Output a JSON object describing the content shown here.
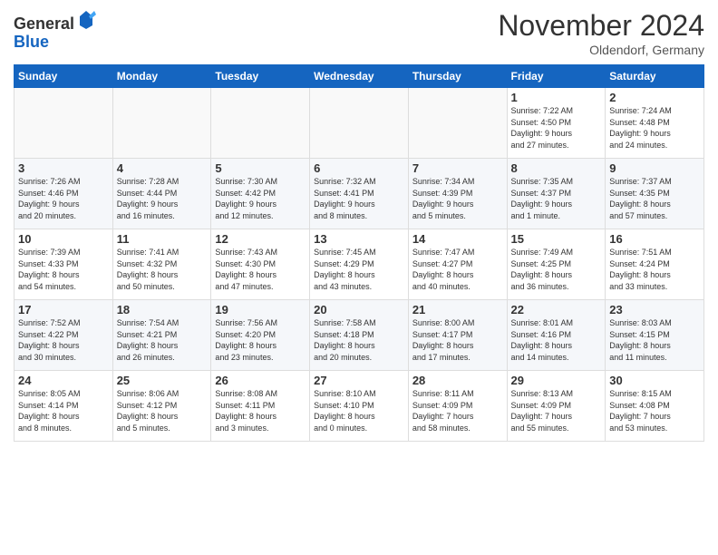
{
  "header": {
    "logo_line1": "General",
    "logo_line2": "Blue",
    "month_title": "November 2024",
    "location": "Oldendorf, Germany"
  },
  "weekdays": [
    "Sunday",
    "Monday",
    "Tuesday",
    "Wednesday",
    "Thursday",
    "Friday",
    "Saturday"
  ],
  "weeks": [
    [
      {
        "day": "",
        "info": ""
      },
      {
        "day": "",
        "info": ""
      },
      {
        "day": "",
        "info": ""
      },
      {
        "day": "",
        "info": ""
      },
      {
        "day": "",
        "info": ""
      },
      {
        "day": "1",
        "info": "Sunrise: 7:22 AM\nSunset: 4:50 PM\nDaylight: 9 hours\nand 27 minutes."
      },
      {
        "day": "2",
        "info": "Sunrise: 7:24 AM\nSunset: 4:48 PM\nDaylight: 9 hours\nand 24 minutes."
      }
    ],
    [
      {
        "day": "3",
        "info": "Sunrise: 7:26 AM\nSunset: 4:46 PM\nDaylight: 9 hours\nand 20 minutes."
      },
      {
        "day": "4",
        "info": "Sunrise: 7:28 AM\nSunset: 4:44 PM\nDaylight: 9 hours\nand 16 minutes."
      },
      {
        "day": "5",
        "info": "Sunrise: 7:30 AM\nSunset: 4:42 PM\nDaylight: 9 hours\nand 12 minutes."
      },
      {
        "day": "6",
        "info": "Sunrise: 7:32 AM\nSunset: 4:41 PM\nDaylight: 9 hours\nand 8 minutes."
      },
      {
        "day": "7",
        "info": "Sunrise: 7:34 AM\nSunset: 4:39 PM\nDaylight: 9 hours\nand 5 minutes."
      },
      {
        "day": "8",
        "info": "Sunrise: 7:35 AM\nSunset: 4:37 PM\nDaylight: 9 hours\nand 1 minute."
      },
      {
        "day": "9",
        "info": "Sunrise: 7:37 AM\nSunset: 4:35 PM\nDaylight: 8 hours\nand 57 minutes."
      }
    ],
    [
      {
        "day": "10",
        "info": "Sunrise: 7:39 AM\nSunset: 4:33 PM\nDaylight: 8 hours\nand 54 minutes."
      },
      {
        "day": "11",
        "info": "Sunrise: 7:41 AM\nSunset: 4:32 PM\nDaylight: 8 hours\nand 50 minutes."
      },
      {
        "day": "12",
        "info": "Sunrise: 7:43 AM\nSunset: 4:30 PM\nDaylight: 8 hours\nand 47 minutes."
      },
      {
        "day": "13",
        "info": "Sunrise: 7:45 AM\nSunset: 4:29 PM\nDaylight: 8 hours\nand 43 minutes."
      },
      {
        "day": "14",
        "info": "Sunrise: 7:47 AM\nSunset: 4:27 PM\nDaylight: 8 hours\nand 40 minutes."
      },
      {
        "day": "15",
        "info": "Sunrise: 7:49 AM\nSunset: 4:25 PM\nDaylight: 8 hours\nand 36 minutes."
      },
      {
        "day": "16",
        "info": "Sunrise: 7:51 AM\nSunset: 4:24 PM\nDaylight: 8 hours\nand 33 minutes."
      }
    ],
    [
      {
        "day": "17",
        "info": "Sunrise: 7:52 AM\nSunset: 4:22 PM\nDaylight: 8 hours\nand 30 minutes."
      },
      {
        "day": "18",
        "info": "Sunrise: 7:54 AM\nSunset: 4:21 PM\nDaylight: 8 hours\nand 26 minutes."
      },
      {
        "day": "19",
        "info": "Sunrise: 7:56 AM\nSunset: 4:20 PM\nDaylight: 8 hours\nand 23 minutes."
      },
      {
        "day": "20",
        "info": "Sunrise: 7:58 AM\nSunset: 4:18 PM\nDaylight: 8 hours\nand 20 minutes."
      },
      {
        "day": "21",
        "info": "Sunrise: 8:00 AM\nSunset: 4:17 PM\nDaylight: 8 hours\nand 17 minutes."
      },
      {
        "day": "22",
        "info": "Sunrise: 8:01 AM\nSunset: 4:16 PM\nDaylight: 8 hours\nand 14 minutes."
      },
      {
        "day": "23",
        "info": "Sunrise: 8:03 AM\nSunset: 4:15 PM\nDaylight: 8 hours\nand 11 minutes."
      }
    ],
    [
      {
        "day": "24",
        "info": "Sunrise: 8:05 AM\nSunset: 4:14 PM\nDaylight: 8 hours\nand 8 minutes."
      },
      {
        "day": "25",
        "info": "Sunrise: 8:06 AM\nSunset: 4:12 PM\nDaylight: 8 hours\nand 5 minutes."
      },
      {
        "day": "26",
        "info": "Sunrise: 8:08 AM\nSunset: 4:11 PM\nDaylight: 8 hours\nand 3 minutes."
      },
      {
        "day": "27",
        "info": "Sunrise: 8:10 AM\nSunset: 4:10 PM\nDaylight: 8 hours\nand 0 minutes."
      },
      {
        "day": "28",
        "info": "Sunrise: 8:11 AM\nSunset: 4:09 PM\nDaylight: 7 hours\nand 58 minutes."
      },
      {
        "day": "29",
        "info": "Sunrise: 8:13 AM\nSunset: 4:09 PM\nDaylight: 7 hours\nand 55 minutes."
      },
      {
        "day": "30",
        "info": "Sunrise: 8:15 AM\nSunset: 4:08 PM\nDaylight: 7 hours\nand 53 minutes."
      }
    ]
  ]
}
